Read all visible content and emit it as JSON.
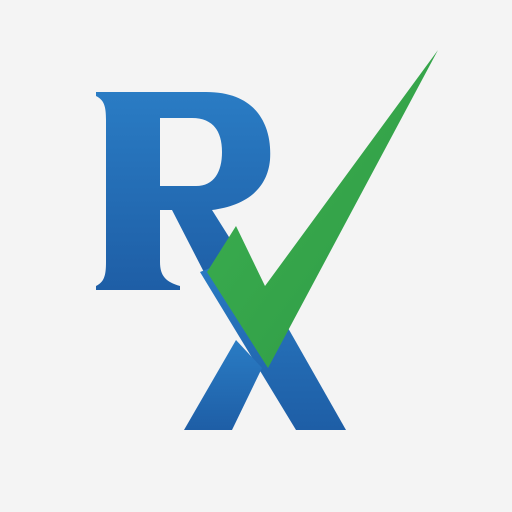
{
  "logo": {
    "letters": "Rx",
    "icon": "rx-checkmark-logo",
    "colors": {
      "background": "#f4f4f4",
      "letter_blue_top": "#2a7cc4",
      "letter_blue_bottom": "#1e5ea6",
      "check_green": "#3cb050",
      "check_green_dark": "#2f9a45"
    }
  }
}
